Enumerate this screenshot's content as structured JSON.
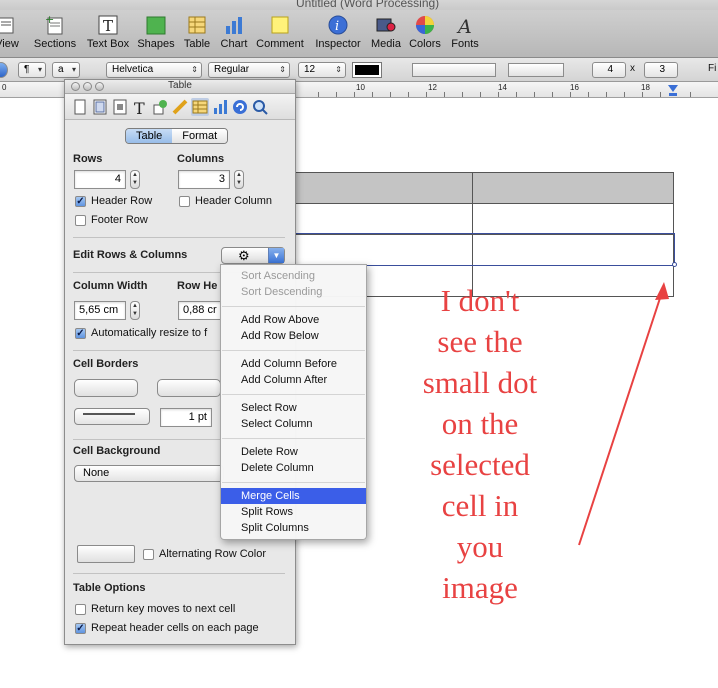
{
  "window": {
    "title": "Untitled (Word Processing)"
  },
  "toolbar": {
    "items": [
      {
        "label": "View",
        "icon": "view-icon"
      },
      {
        "label": "Sections",
        "icon": "sections-icon"
      },
      {
        "label": "Text Box",
        "icon": "textbox-icon"
      },
      {
        "label": "Shapes",
        "icon": "shapes-icon"
      },
      {
        "label": "Table",
        "icon": "table-icon"
      },
      {
        "label": "Chart",
        "icon": "chart-icon"
      },
      {
        "label": "Comment",
        "icon": "comment-icon"
      },
      {
        "label": "Inspector",
        "icon": "inspector-icon"
      },
      {
        "label": "Media",
        "icon": "media-icon"
      },
      {
        "label": "Colors",
        "icon": "colors-icon"
      },
      {
        "label": "Fonts",
        "icon": "fonts-icon"
      }
    ]
  },
  "formatbar": {
    "style_char": "¶",
    "style_a": "a",
    "font_family": "Helvetica",
    "font_style": "Regular",
    "font_size": "12",
    "columns": "4",
    "times": "x",
    "rows": "3",
    "fit": "Fi"
  },
  "ruler": {
    "zero": "0",
    "labels": [
      "10",
      "12",
      "14",
      "16",
      "18"
    ]
  },
  "inspector": {
    "title": "Table",
    "tabs": [
      "Table",
      "Format"
    ],
    "active_tab": "Table",
    "rows_label": "Rows",
    "rows_value": "4",
    "columns_label": "Columns",
    "columns_value": "3",
    "header_row": "Header Row",
    "header_column": "Header Column",
    "footer_row": "Footer Row",
    "edit_rows_cols": "Edit Rows & Columns",
    "column_width_label": "Column Width",
    "column_width_value": "5,65 cm",
    "row_height_label": "Row He",
    "row_height_value": "0,88 cr",
    "auto_resize": "Automatically resize to f",
    "cell_borders": "Cell Borders",
    "border_width": "1 pt",
    "cell_background": "Cell Background",
    "cell_background_value": "None",
    "alternating": "Alternating Row Color",
    "table_options": "Table Options",
    "return_key": "Return key moves to next cell",
    "repeat_header": "Repeat header cells on each page"
  },
  "menu": {
    "sort_asc": "Sort Ascending",
    "sort_desc": "Sort Descending",
    "add_row_above": "Add Row Above",
    "add_row_below": "Add Row Below",
    "add_col_before": "Add Column Before",
    "add_col_after": "Add Column After",
    "select_row": "Select Row",
    "select_column": "Select Column",
    "delete_row": "Delete Row",
    "delete_column": "Delete Column",
    "merge_cells": "Merge Cells",
    "split_rows": "Split Rows",
    "split_columns": "Split Columns"
  },
  "annotation": {
    "lines": [
      "I don't",
      "see the",
      "small dot",
      "on the",
      "selected",
      "cell in",
      "you",
      "image"
    ],
    "color": "#e84242"
  },
  "colors": {
    "highlight": "#3b5ee8",
    "header_fill": "#c4c4c4",
    "selection": "#3a4e9c"
  }
}
